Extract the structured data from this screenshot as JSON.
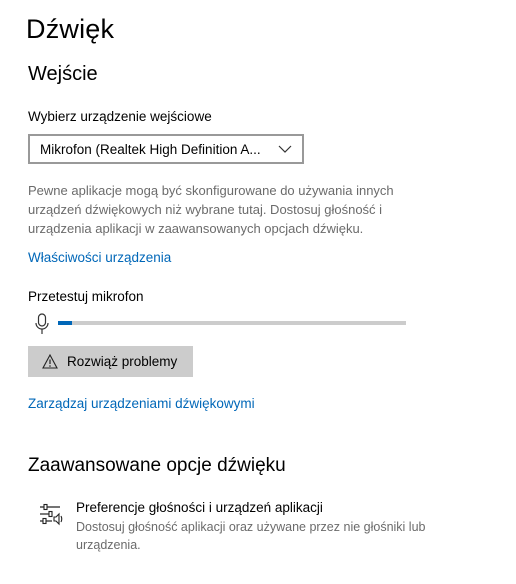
{
  "page": {
    "title": "Dźwięk"
  },
  "input": {
    "section_title": "Wejście",
    "device_label": "Wybierz urządzenie wejściowe",
    "device_value": "Mikrofon (Realtek High Definition A...",
    "description": "Pewne aplikacje mogą być skonfigurowane do używania innych urządzeń dźwiękowych niż wybrane tutaj. Dostosuj głośność i urządzenia aplikacji w zaawansowanych opcjach dźwięku.",
    "device_properties_link": "Właściwości urządzenia",
    "test_mic_label": "Przetestuj mikrofon",
    "mic_level_percent": 4,
    "troubleshoot_button": "Rozwiąż problemy",
    "manage_devices_link": "Zarządzaj urządzeniami dźwiękowymi"
  },
  "advanced": {
    "section_title": "Zaawansowane opcje dźwięku",
    "pref_title": "Preferencje głośności i urządzeń aplikacji",
    "pref_description": "Dostosuj głośność aplikacji oraz używane przez nie głośniki lub urządzenia."
  },
  "icons": {
    "dropdown": "chevron-down-icon",
    "mic": "microphone-icon",
    "warning": "warning-icon",
    "mixer": "mixer-sliders-icon"
  },
  "colors": {
    "accent": "#0067b8",
    "secondary_text": "#6b6b6b",
    "button_bg": "#cccccc",
    "track": "#cccccc"
  }
}
